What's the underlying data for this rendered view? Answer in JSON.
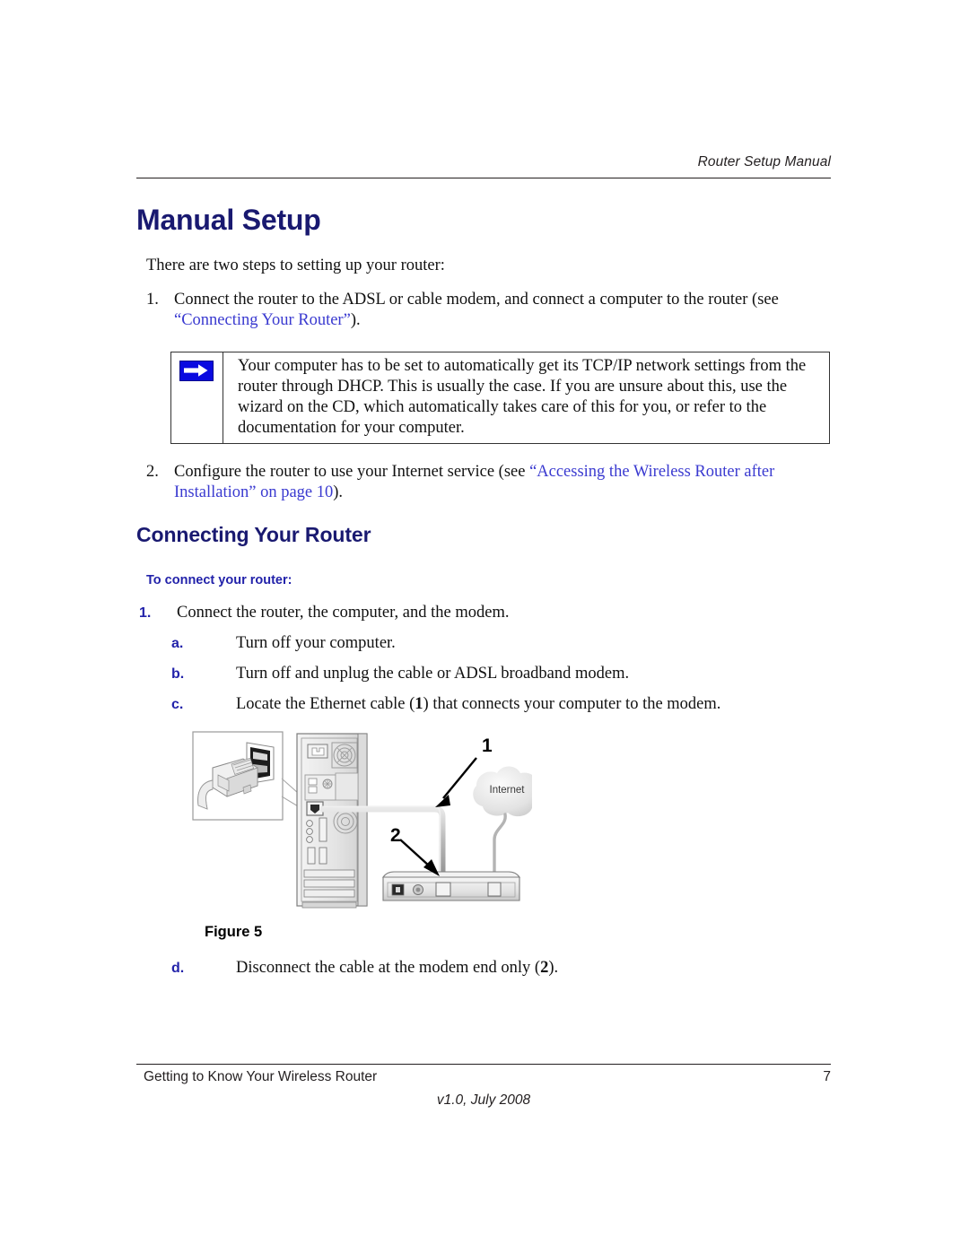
{
  "header": {
    "title": "Router Setup Manual"
  },
  "headings": {
    "page_title": "Manual Setup",
    "section_title": "Connecting Your Router",
    "procedure_title": "To connect your router:"
  },
  "intro": {
    "text": "There are two steps to setting up your router:"
  },
  "steps": [
    {
      "marker": "1.",
      "text_before": "Connect the router to the ADSL or cable modem, and connect a computer to the router (see ",
      "link": "“Connecting Your Router”",
      "text_after": ")."
    },
    {
      "marker": "2.",
      "text_before": "Configure the router to use your Internet service (see ",
      "link": "“Accessing the Wireless Router after Installation” on page 10",
      "text_after": ")."
    }
  ],
  "note": {
    "icon": "note-arrow-icon",
    "text": "Your computer has to be set to automatically get its TCP/IP network settings from the router through DHCP. This is usually the case. If you are unsure about this, use the wizard on the CD, which automatically takes care of this for you, or refer to the documentation for your computer."
  },
  "procedure": {
    "items": [
      {
        "marker": "1.",
        "level": 1,
        "text": "Connect the router, the computer, and the modem."
      },
      {
        "marker": "a.",
        "level": 2,
        "text": "Turn off your computer."
      },
      {
        "marker": "b.",
        "level": 2,
        "text": "Turn off and unplug the cable or ADSL broadband modem."
      },
      {
        "marker": "c.",
        "level": 2,
        "text_before": "Locate the Ethernet cable (",
        "callout": "1",
        "text_after": ") that connects your computer to the modem."
      }
    ],
    "final_item": {
      "marker": "d.",
      "level": 2,
      "text_before": "Disconnect the cable at the modem end only (",
      "callout": "2",
      "text_after": ")."
    }
  },
  "figure": {
    "caption": "Figure 5",
    "callout_1": "1",
    "callout_2": "2",
    "cloud_label": "Internet"
  },
  "footer": {
    "left": "Getting to Know Your Wireless Router",
    "page_number": "7",
    "version": "v1.0, July 2008"
  },
  "colors": {
    "heading_navy": "#191970",
    "link_blue": "#3a3ad0",
    "marker_blue": "#2222aa",
    "note_icon_blue": "#0a0ae0"
  }
}
